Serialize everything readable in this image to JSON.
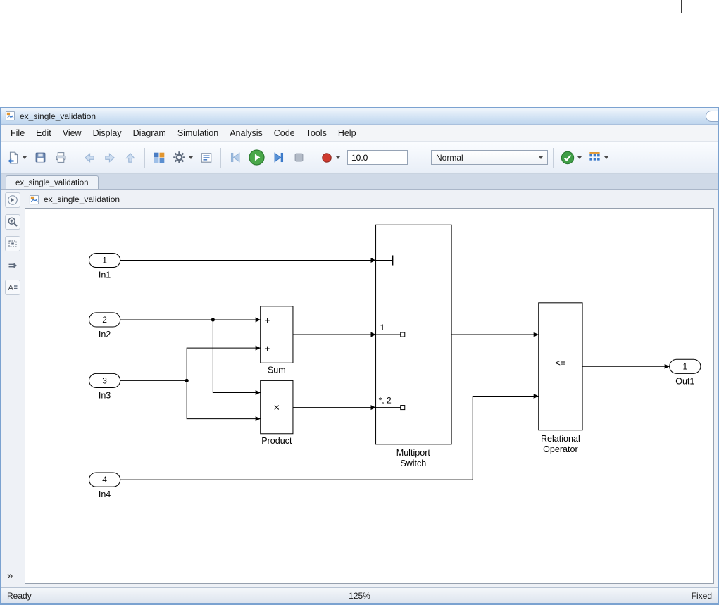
{
  "window": {
    "title": "ex_single_validation",
    "menu": [
      "File",
      "Edit",
      "View",
      "Display",
      "Diagram",
      "Simulation",
      "Analysis",
      "Code",
      "Tools",
      "Help"
    ],
    "toolbar": {
      "sim_time": "10.0",
      "sim_mode": "Normal"
    },
    "tab": "ex_single_validation",
    "breadcrumb": "ex_single_validation",
    "status": {
      "ready": "Ready",
      "zoom": "125%",
      "solver": "Fixed"
    }
  },
  "palette": {
    "more_glyph": "»"
  },
  "icons": {
    "annotation_glyph": "A"
  },
  "diagram": {
    "in1": {
      "port": "1",
      "label": "In1"
    },
    "in2": {
      "port": "2",
      "label": "In2"
    },
    "in3": {
      "port": "3",
      "label": "In3"
    },
    "in4": {
      "port": "4",
      "label": "In4"
    },
    "sum": {
      "label": "Sum",
      "plus1": "+",
      "plus2": "+"
    },
    "product": {
      "label": "Product",
      "op": "×"
    },
    "mswitch": {
      "label_line1": "Multiport",
      "label_line2": "Switch",
      "port1_label": "1",
      "port2_label": "*, 2"
    },
    "relop": {
      "op": "<=",
      "label_line1": "Relational",
      "label_line2": "Operator"
    },
    "out1": {
      "port": "1",
      "label": "Out1"
    }
  }
}
